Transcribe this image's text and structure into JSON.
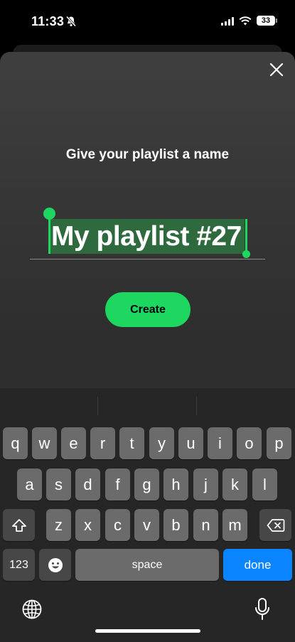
{
  "status": {
    "time": "11:33",
    "battery": "33"
  },
  "sheet": {
    "prompt": "Give your playlist a name",
    "playlist_name": "My playlist #27",
    "create_label": "Create"
  },
  "keyboard": {
    "row1": [
      "q",
      "w",
      "e",
      "r",
      "t",
      "y",
      "u",
      "i",
      "o",
      "p"
    ],
    "row2": [
      "a",
      "s",
      "d",
      "f",
      "g",
      "h",
      "j",
      "k",
      "l"
    ],
    "row3": [
      "z",
      "x",
      "c",
      "v",
      "b",
      "n",
      "m"
    ],
    "numbers_label": "123",
    "space_label": "space",
    "done_label": "done"
  },
  "colors": {
    "accent": "#1ed760",
    "selection": "#2e6a3e",
    "done_key": "#0a84ff"
  }
}
